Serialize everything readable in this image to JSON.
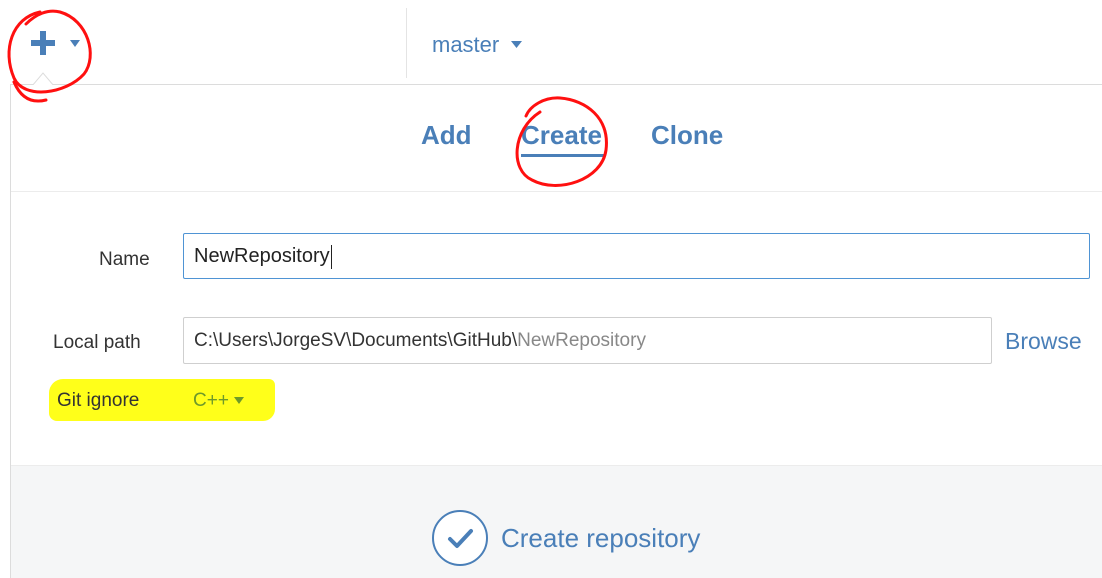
{
  "colors": {
    "accent": "#4a7fb8",
    "highlight": "#ffff1a",
    "annotation": "#ff0000",
    "gitignore_value": "#6e9a2a"
  },
  "toolbar": {
    "add_icon": "plus-icon",
    "branch": "master"
  },
  "tabs": {
    "items": [
      {
        "label": "Add"
      },
      {
        "label": "Create",
        "active": true
      },
      {
        "label": "Clone"
      }
    ]
  },
  "form": {
    "name_label": "Name",
    "name_value": "NewRepository",
    "path_label": "Local path",
    "path_prefix": "C:\\Users\\JorgeSV\\Documents\\GitHub\\",
    "path_suffix": "NewRepository",
    "browse_label": "Browse",
    "gitignore_label": "Git ignore",
    "gitignore_value": "C++"
  },
  "footer": {
    "create_button_label": "Create repository",
    "create_icon": "check-circle-icon"
  }
}
